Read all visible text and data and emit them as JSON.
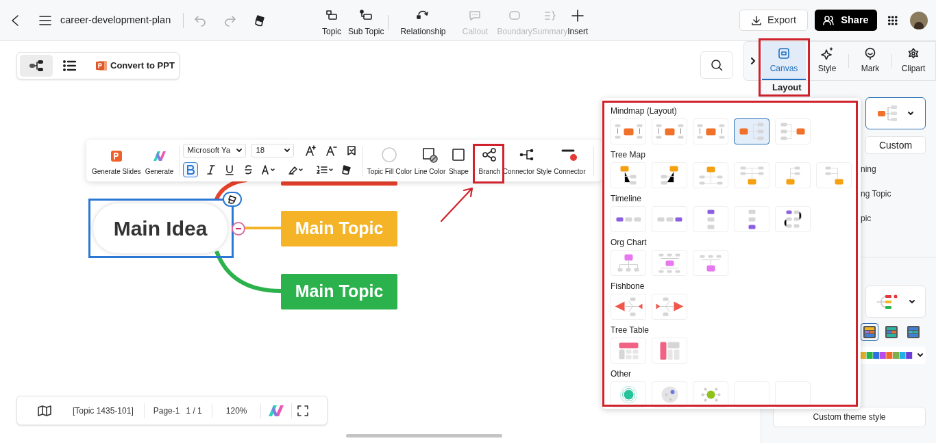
{
  "header": {
    "title": "career-development-plan",
    "tools": [
      {
        "label": "Topic",
        "disabled": false
      },
      {
        "label": "Sub Topic",
        "disabled": false
      },
      {
        "label": "Relationship",
        "disabled": false
      },
      {
        "label": "Callout",
        "disabled": true
      },
      {
        "label": "Boundary",
        "disabled": true
      },
      {
        "label": "Summary",
        "disabled": true
      },
      {
        "label": "Insert",
        "disabled": false
      }
    ],
    "export": "Export",
    "share": "Share"
  },
  "view_switcher": {
    "modes": [
      {
        "selected": true
      },
      {
        "selected": false
      }
    ],
    "convert": "Convert to PPT"
  },
  "side_tabs": [
    {
      "label": "Canvas",
      "selected": true
    },
    {
      "label": "Style",
      "selected": false
    },
    {
      "label": "Mark",
      "selected": false
    },
    {
      "label": "Clipart",
      "selected": false
    }
  ],
  "side_caption": "Layout",
  "format_toolbar": {
    "generate": [
      "Generate Slides",
      "Generate"
    ],
    "font_name": "Microsoft Ya",
    "font_size": "18",
    "bold": true,
    "actions": [
      "Topic Fill Color",
      "Line Color",
      "Shape",
      "Branch",
      "Connector Style",
      "Connector"
    ]
  },
  "mindmap": {
    "central": "Main Idea",
    "topics": [
      {
        "color": "#e8412c"
      },
      {
        "label": "Main Topic",
        "color": "#f5b427"
      },
      {
        "label": "Main Topic",
        "color": "#2bb24c"
      }
    ]
  },
  "layout_menu": {
    "groups": [
      {
        "title": "Mindmap (Layout)",
        "kind": "mindmap",
        "options": [
          {
            "selected": false
          },
          {
            "selected": false
          },
          {
            "selected": false
          },
          {
            "selected": true
          },
          {
            "selected": false
          }
        ]
      },
      {
        "title": "Tree Map",
        "kind": "tree",
        "options": [
          {
            "selected": false
          },
          {
            "selected": false
          },
          {
            "selected": false
          },
          {
            "selected": false
          },
          {
            "selected": false
          },
          {
            "selected": false
          }
        ]
      },
      {
        "title": "Timeline",
        "kind": "timeline",
        "options": [
          {
            "selected": false
          },
          {
            "selected": false
          },
          {
            "selected": false
          },
          {
            "selected": false
          },
          {
            "selected": false
          }
        ]
      },
      {
        "title": "Org Chart",
        "kind": "org",
        "options": [
          {
            "selected": false
          },
          {
            "selected": false
          },
          {
            "selected": false
          }
        ]
      },
      {
        "title": "Fishbone",
        "kind": "fishbone",
        "options": [
          {
            "selected": false
          },
          {
            "selected": false
          }
        ]
      },
      {
        "title": "Tree Table",
        "kind": "table",
        "options": [
          {
            "selected": false
          },
          {
            "selected": false
          }
        ]
      },
      {
        "title": "Other",
        "kind": "other",
        "options": [
          {
            "selected": false
          },
          {
            "selected": false
          },
          {
            "selected": false
          },
          {
            "selected": false
          },
          {
            "selected": false
          }
        ]
      }
    ]
  },
  "right_panel": {
    "custom": "Custom",
    "items": [
      "ning",
      "ng Topic",
      "pic"
    ],
    "palettes": [
      {
        "selected": true
      },
      {
        "selected": false
      },
      {
        "selected": false
      }
    ],
    "custom_theme": "Custom theme style"
  },
  "status_bar": {
    "topic": "[Topic 1435-101]",
    "page": "Page-1",
    "count": "1 / 1",
    "zoom": "120%"
  }
}
